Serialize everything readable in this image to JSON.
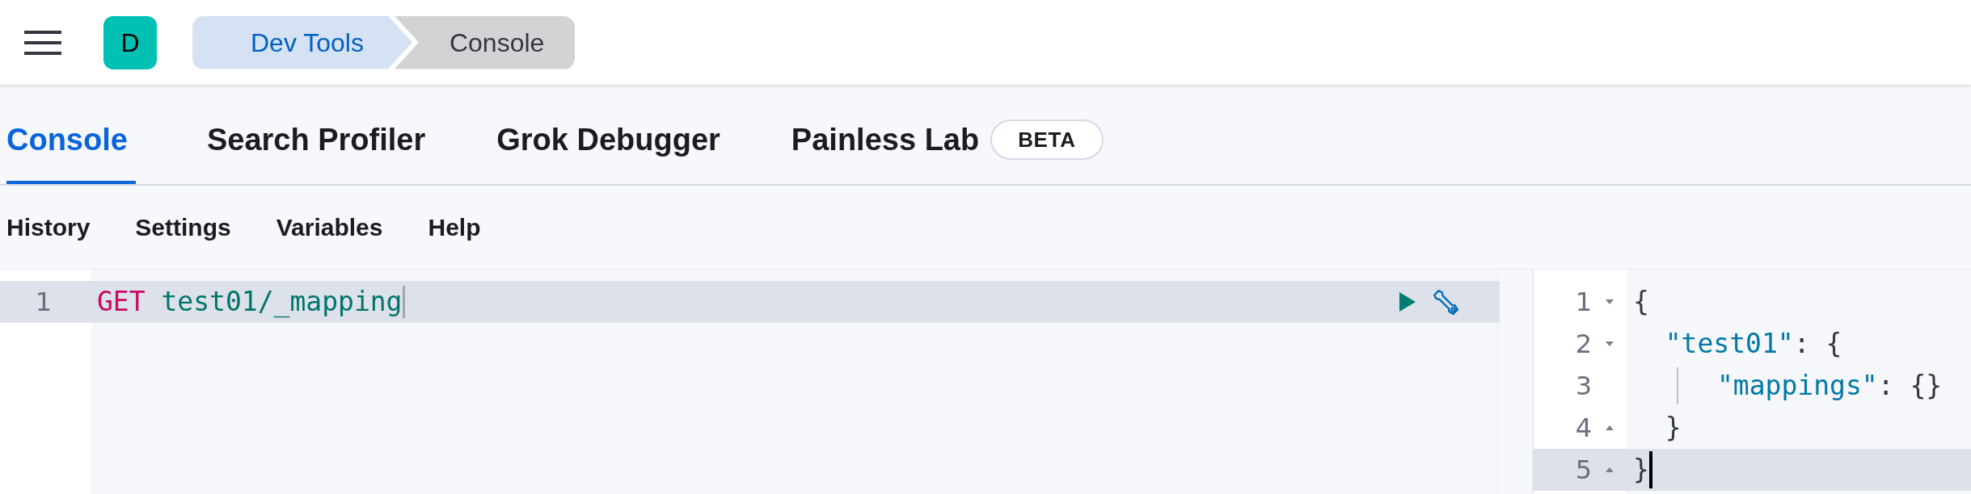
{
  "header": {
    "avatar": "D",
    "breadcrumbs": [
      {
        "label": "Dev Tools",
        "selected": false
      },
      {
        "label": "Console",
        "selected": true
      }
    ]
  },
  "tabs": [
    {
      "label": "Console",
      "selected": true
    },
    {
      "label": "Search Profiler",
      "selected": false
    },
    {
      "label": "Grok Debugger",
      "selected": false
    },
    {
      "label": "Painless Lab",
      "selected": false,
      "badge": "BETA"
    }
  ],
  "menu": [
    "History",
    "Settings",
    "Variables",
    "Help"
  ],
  "request_editor": {
    "lines": [
      {
        "number": "1",
        "active": true,
        "tokens": [
          {
            "kind": "method",
            "text": "GET"
          },
          {
            "kind": "path",
            "text": " test01/_mapping"
          }
        ]
      }
    ]
  },
  "response_editor": {
    "lines": [
      {
        "number": "1",
        "fold_start": true,
        "fold_end": false,
        "active": false,
        "indent_guide": false,
        "tokens": [
          {
            "kind": "punct",
            "text": "{"
          }
        ]
      },
      {
        "number": "2",
        "fold_start": true,
        "fold_end": false,
        "active": false,
        "indent_guide": false,
        "tokens": [
          {
            "kind": "key",
            "text": "  \"test01\""
          },
          {
            "kind": "punct",
            "text": ": {"
          }
        ]
      },
      {
        "number": "3",
        "fold_start": false,
        "fold_end": false,
        "active": false,
        "indent_guide": true,
        "tokens": [
          {
            "kind": "key",
            "text": "\"mappings\""
          },
          {
            "kind": "punct",
            "text": ": {}"
          }
        ]
      },
      {
        "number": "4",
        "fold_start": false,
        "fold_end": true,
        "active": false,
        "indent_guide": false,
        "tokens": [
          {
            "kind": "punct",
            "text": "  }"
          }
        ]
      },
      {
        "number": "5",
        "fold_start": false,
        "fold_end": true,
        "active": true,
        "indent_guide": false,
        "tokens": [
          {
            "kind": "punct",
            "text": "}"
          }
        ]
      }
    ]
  }
}
